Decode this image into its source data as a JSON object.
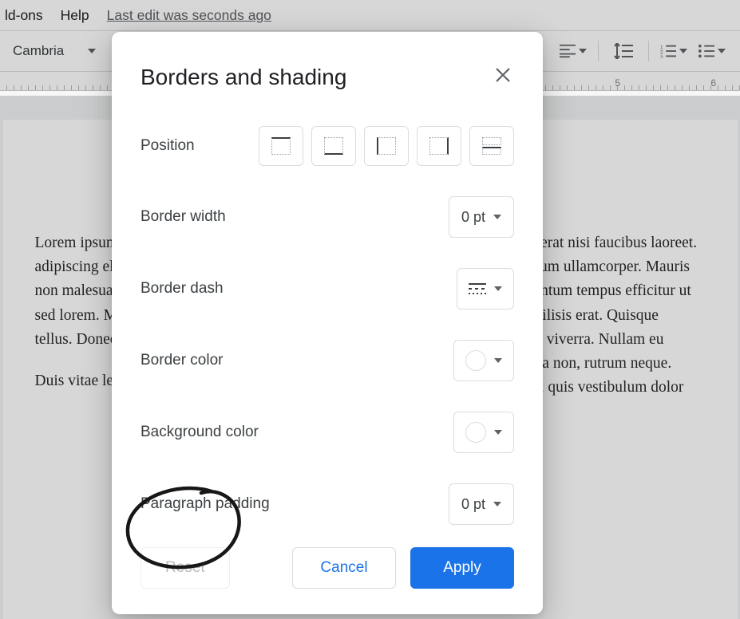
{
  "menu": {
    "addons": "ld-ons",
    "help": "Help",
    "last_edit": "Last edit was seconds ago"
  },
  "toolbar": {
    "font": "Cambria"
  },
  "ruler": {
    "marks": [
      "5",
      "6"
    ]
  },
  "document": {
    "col1_p1": "Lorem ipsum dolor sit amet, consectetur adipiscing elit mauris. Suspendisse turpis sapien, non malesuada libero accumsan deit mollis urna sed lorem. Maecenas a dapibus tellus. Nulla sed tellus. Donec ac est. Sed id erat.",
    "col1_p2": "Duis vitae leo tempor congue condimentum id dui.",
    "col2_p1": "Praesent malesuada placerat nisi faucibus laoreet. Nulla imperdiet vestibulum ullamcorper. Mauris in nisi tempor sed elementum tempus efficitur ut tellus. Nunc pulvinar facilisis erat. Quisque volutpat sagittis arcu sed viverra. Nullam eu ipsum iaculis, auctor urna non, rutrum neque. Proin laoreet tortor risus, quis vestibulum dolor"
  },
  "dialog": {
    "title": "Borders and shading",
    "labels": {
      "position": "Position",
      "border_width": "Border width",
      "border_dash": "Border dash",
      "border_color": "Border color",
      "background_color": "Background color",
      "paragraph_padding": "Paragraph padding"
    },
    "values": {
      "border_width": "0 pt",
      "paragraph_padding": "0 pt"
    },
    "buttons": {
      "reset": "Reset",
      "cancel": "Cancel",
      "apply": "Apply"
    }
  }
}
